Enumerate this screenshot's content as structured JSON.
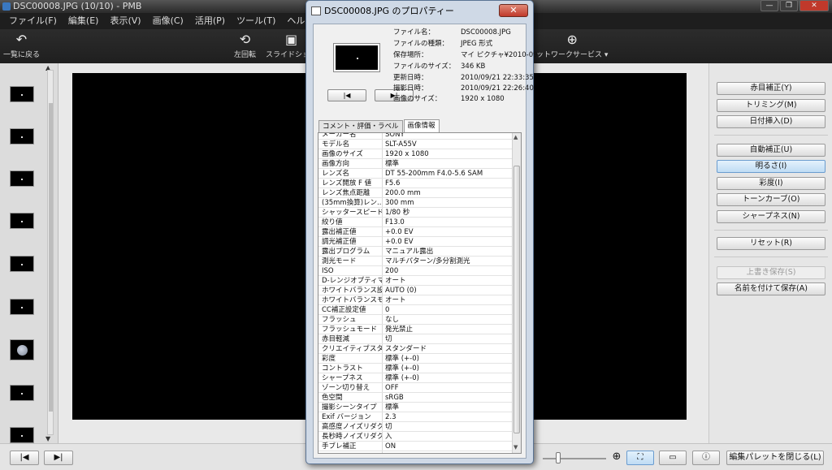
{
  "app": {
    "title": "DSC00008.JPG (10/10) - PMB",
    "window_controls": {
      "minimize": "—",
      "maximize": "❐",
      "close": "✕"
    }
  },
  "menu": [
    "ファイル(F)",
    "編集(E)",
    "表示(V)",
    "画像(C)",
    "活用(P)",
    "ツール(T)",
    "ヘルプ(H)"
  ],
  "toolbar": {
    "back_label": "一覧に戻る",
    "rotate_label": "左回転",
    "slideshow_label": "スライドショー",
    "network_label": "ットワークサービス ▾"
  },
  "thumb_strip": {
    "scroll_up": "▲",
    "scroll_down": "▼",
    "count": 10
  },
  "right_panel": {
    "buttons": [
      "赤目補正(Y)",
      "トリミング(M)",
      "日付挿入(D)",
      "自動補正(U)",
      "明るさ(I)",
      "彩度(I)",
      "トーンカーブ(O)",
      "シャープネス(N)",
      "リセット(R)",
      "上書き保存(S)",
      "名前を付けて保存(A)"
    ],
    "active_index": 4,
    "disabled_index": 9
  },
  "bottom": {
    "prev_label": "|◀",
    "next_label": "▶|",
    "zoom_in_icon": "⊕",
    "fit_icon": "⛶",
    "compare_icon": "▭",
    "info_icon": "ⓘ",
    "close_palette_label": "編集パレットを閉じる(L)"
  },
  "dialog": {
    "title": "DSC00008.JPG のプロパティー",
    "close": "✕",
    "nav_prev": "|◀",
    "nav_next": "▶|",
    "info": [
      {
        "label": "ファイル名：",
        "value": "DSC00008.JPG"
      },
      {
        "label": "ファイルの種類：",
        "value": "JPEG 形式"
      },
      {
        "label": "保存場所：",
        "value": "マイ ピクチャ¥2010-09"
      },
      {
        "label": "ファイルのサイズ：",
        "value": "346 KB"
      },
      {
        "label": "更新日時：",
        "value": "2010/09/21 22:33:35"
      },
      {
        "label": "撮影日時：",
        "value": "2010/09/21 22:26:40"
      },
      {
        "label": "画像のサイズ：",
        "value": "1920 x 1080"
      }
    ],
    "tabs": [
      "コメント・評価・ラベル",
      "画像情報"
    ],
    "active_tab": 1,
    "properties": [
      {
        "k": "メーカー名",
        "v": "SONY"
      },
      {
        "k": "モデル名",
        "v": "SLT-A55V"
      },
      {
        "k": "画像のサイズ",
        "v": "1920 x 1080"
      },
      {
        "k": "画像方向",
        "v": "標準"
      },
      {
        "k": "レンズ名",
        "v": "DT 55-200mm F4.0-5.6 SAM"
      },
      {
        "k": "レンズ開放 F 値",
        "v": "F5.6"
      },
      {
        "k": "レンズ焦点距離",
        "v": "200.0 mm"
      },
      {
        "k": "(35mm換算)レン...",
        "v": "300 mm"
      },
      {
        "k": "シャッタースピード",
        "v": "1/80 秒"
      },
      {
        "k": "絞り値",
        "v": "F13.0"
      },
      {
        "k": "露出補正値",
        "v": "+0.0 EV"
      },
      {
        "k": "調光補正値",
        "v": "+0.0 EV"
      },
      {
        "k": "露出プログラム",
        "v": "マニュアル露出"
      },
      {
        "k": "測光モード",
        "v": "マルチパターン/多分割測光"
      },
      {
        "k": "ISO",
        "v": "200"
      },
      {
        "k": "D-レンジオプティマ...",
        "v": "オート"
      },
      {
        "k": "ホワイトバランス設...",
        "v": "AUTO (0)"
      },
      {
        "k": "ホワイトバランスモ...",
        "v": "オート"
      },
      {
        "k": "CC補正設定値",
        "v": "0"
      },
      {
        "k": "フラッシュ",
        "v": "なし"
      },
      {
        "k": "フラッシュモード",
        "v": "発光禁止"
      },
      {
        "k": "赤目軽減",
        "v": "切"
      },
      {
        "k": "クリエイティブスタイル",
        "v": "スタンダード"
      },
      {
        "k": "彩度",
        "v": "標準 (+-0)"
      },
      {
        "k": "コントラスト",
        "v": "標準 (+-0)"
      },
      {
        "k": "シャープネス",
        "v": "標準 (+-0)"
      },
      {
        "k": "ゾーン切り替え",
        "v": "OFF"
      },
      {
        "k": "色空間",
        "v": "sRGB"
      },
      {
        "k": "撮影シーンタイプ",
        "v": "標準"
      },
      {
        "k": "Exif バージョン",
        "v": "2.3"
      },
      {
        "k": "高感度ノイズリダク...",
        "v": "切"
      },
      {
        "k": "長秒時ノイズリダク...",
        "v": "入"
      },
      {
        "k": "手ブレ補正",
        "v": "ON"
      }
    ]
  }
}
